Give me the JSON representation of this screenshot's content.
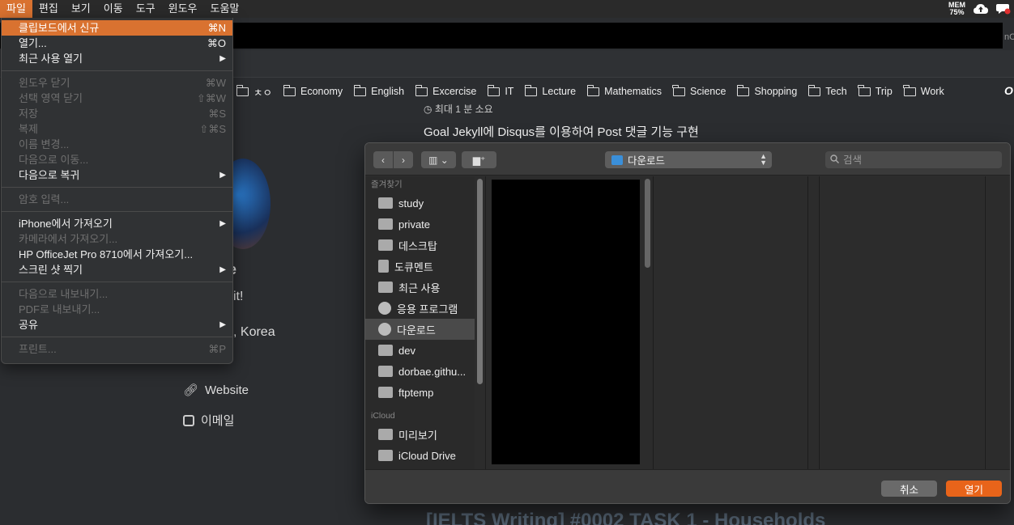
{
  "menubar": {
    "items": [
      {
        "label": "파일",
        "active": true
      },
      {
        "label": "편집"
      },
      {
        "label": "보기"
      },
      {
        "label": "이동"
      },
      {
        "label": "도구"
      },
      {
        "label": "윈도우"
      },
      {
        "label": "도움말"
      }
    ],
    "mem_label": "MEM",
    "mem_value": "75%"
  },
  "browser": {
    "address_tail": "nC",
    "bookmarks": [
      "ㅊㅇ",
      "Economy",
      "English",
      "Excercise",
      "IT",
      "Lecture",
      "Mathematics",
      "Science",
      "Shopping",
      "Tech",
      "Trip",
      "Work"
    ],
    "bookmarks_more": "O"
  },
  "page": {
    "post_time": "최대 1 분 소요",
    "post_title": "Goal Jekyll에 Disqus를 이용하여 Post 댓글 기능 구현",
    "sidebar_name_tail": "e",
    "sidebar_bio_tail": "it!",
    "sidebar_location_tail": ", Korea",
    "website_label": "Website",
    "email_label": "이메일",
    "bottom_title": "[IELTS Writing] #0002 TASK 1 - Households"
  },
  "file_menu": {
    "items": [
      {
        "label": "클립보드에서 신규",
        "shortcut": "⌘N",
        "highlighted": true
      },
      {
        "label": "열기...",
        "shortcut": "⌘O"
      },
      {
        "label": "최근 사용 열기",
        "submenu": true
      },
      {
        "separator": true
      },
      {
        "label": "윈도우 닫기",
        "shortcut": "⌘W",
        "disabled": true
      },
      {
        "label": "선택 영역 닫기",
        "shortcut": "⇧⌘W",
        "disabled": true
      },
      {
        "label": "저장",
        "shortcut": "⌘S",
        "disabled": true
      },
      {
        "label": "복제",
        "shortcut": "⇧⌘S",
        "disabled": true
      },
      {
        "label": "이름 변경...",
        "disabled": true
      },
      {
        "label": "다음으로 이동...",
        "disabled": true
      },
      {
        "label": "다음으로 복귀",
        "submenu": true
      },
      {
        "separator": true
      },
      {
        "label": "암호 입력...",
        "disabled": true
      },
      {
        "separator": true
      },
      {
        "label": "iPhone에서 가져오기",
        "submenu": true
      },
      {
        "label": "카메라에서 가져오기...",
        "disabled": true
      },
      {
        "label": "HP OfficeJet Pro 8710에서 가져오기..."
      },
      {
        "label": "스크린 샷 찍기",
        "submenu": true
      },
      {
        "separator": true
      },
      {
        "label": "다음으로 내보내기...",
        "disabled": true
      },
      {
        "label": "PDF로 내보내기...",
        "disabled": true
      },
      {
        "label": "공유",
        "submenu": true
      },
      {
        "separator": true
      },
      {
        "label": "프린트...",
        "shortcut": "⌘P",
        "disabled": true
      }
    ]
  },
  "dialog": {
    "location": "다운로드",
    "search_placeholder": "검색",
    "favorites_header": "즐겨찾기",
    "favorites": [
      {
        "label": "study",
        "icon": "folder-icon"
      },
      {
        "label": "private",
        "icon": "folder-icon"
      },
      {
        "label": "데스크탑",
        "icon": "desktop-icon"
      },
      {
        "label": "도큐멘트",
        "icon": "document-icon"
      },
      {
        "label": "최근 사용",
        "icon": "recents-icon"
      },
      {
        "label": "응용 프로그램",
        "icon": "applications-icon"
      },
      {
        "label": "다운로드",
        "icon": "downloads-icon",
        "selected": true
      },
      {
        "label": "dev",
        "icon": "folder-icon"
      },
      {
        "label": "dorbae.githu...",
        "icon": "folder-icon"
      },
      {
        "label": "ftptemp",
        "icon": "folder-icon"
      }
    ],
    "icloud_header": "iCloud",
    "icloud": [
      {
        "label": "미리보기",
        "icon": "preview-app-icon"
      },
      {
        "label": "iCloud Drive",
        "icon": "cloud-icon"
      }
    ],
    "cancel_label": "취소",
    "open_label": "열기"
  }
}
